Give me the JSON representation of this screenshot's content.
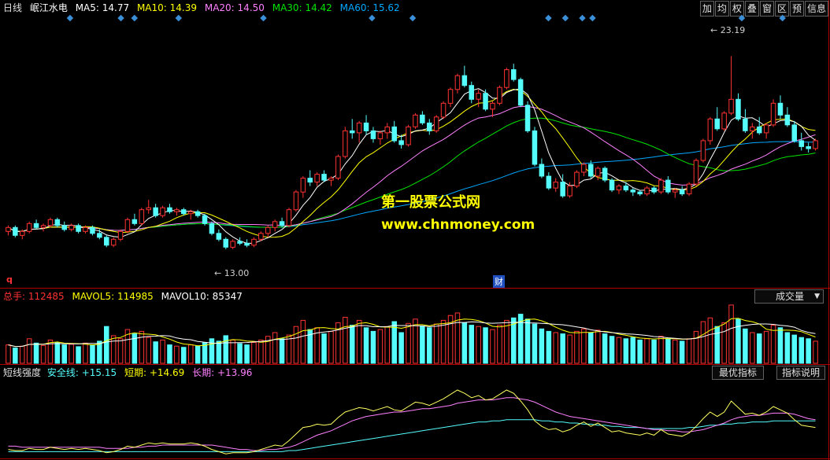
{
  "header": {
    "period": "日线",
    "stock_name": "岷江水电",
    "ma5_label": "MA5:",
    "ma5": "14.77",
    "ma10_label": "MA10:",
    "ma10": "14.39",
    "ma20_label": "MA20:",
    "ma20": "14.50",
    "ma30_label": "MA30:",
    "ma30": "14.42",
    "ma60_label": "MA60:",
    "ma60": "15.62"
  },
  "toolbar": [
    "加",
    "均",
    "权",
    "叠",
    "窗",
    "区",
    "预",
    "信息"
  ],
  "annotations": {
    "high": "23.19",
    "low": "13.00",
    "q_marker": "q",
    "fin_marker": "财"
  },
  "watermark": {
    "line1": "第一股票公式网",
    "line2": "www.chnmoney.com"
  },
  "volume_header": {
    "total_label": "总手:",
    "total": "112485",
    "mavol5_label": "MAVOL5:",
    "mavol5": "114985",
    "mavol10_label": "MAVOL10:",
    "mavol10": "85347",
    "selector": "成交量"
  },
  "indicator_header": {
    "name": "短线强度",
    "safe_label": "安全线:",
    "safe": "+15.15",
    "short_label": "短期:",
    "short": "+14.69",
    "long_label": "长期:",
    "long": "+13.96",
    "btn_optimal": "最优指标",
    "btn_help": "指标说明"
  },
  "colors": {
    "up": "#ff3232",
    "down": "#54fcfc",
    "ma5": "#ffffff",
    "ma10": "#ffff00",
    "ma20": "#ff80ff",
    "ma30": "#00e600",
    "ma60": "#00a8ff",
    "marker": "#3a8fd8"
  },
  "chart_data": {
    "type": "candlestick",
    "price_range": [
      12.0,
      24.2
    ],
    "candles": [
      [
        14.3,
        14.6,
        14.1,
        14.5
      ],
      [
        14.5,
        14.6,
        14.0,
        14.1
      ],
      [
        14.1,
        14.4,
        13.9,
        14.3
      ],
      [
        14.3,
        14.8,
        14.2,
        14.7
      ],
      [
        14.7,
        14.9,
        14.4,
        14.5
      ],
      [
        14.5,
        14.7,
        14.3,
        14.6
      ],
      [
        14.6,
        15.0,
        14.5,
        14.9
      ],
      [
        14.9,
        15.0,
        14.5,
        14.6
      ],
      [
        14.6,
        14.8,
        14.3,
        14.4
      ],
      [
        14.4,
        14.7,
        14.3,
        14.6
      ],
      [
        14.6,
        14.7,
        14.2,
        14.3
      ],
      [
        14.3,
        14.6,
        14.2,
        14.5
      ],
      [
        14.5,
        14.6,
        14.1,
        14.2
      ],
      [
        14.2,
        14.4,
        13.9,
        14.0
      ],
      [
        14.0,
        14.1,
        13.5,
        13.6
      ],
      [
        13.6,
        14.0,
        13.5,
        13.9
      ],
      [
        13.9,
        14.4,
        13.8,
        14.3
      ],
      [
        14.3,
        15.0,
        14.2,
        14.9
      ],
      [
        14.9,
        15.2,
        14.6,
        14.7
      ],
      [
        14.7,
        15.5,
        14.6,
        15.4
      ],
      [
        15.4,
        15.9,
        15.2,
        15.5
      ],
      [
        15.5,
        15.7,
        15.0,
        15.1
      ],
      [
        15.1,
        15.6,
        15.0,
        15.5
      ],
      [
        15.5,
        15.7,
        15.2,
        15.3
      ],
      [
        15.3,
        15.5,
        15.1,
        15.4
      ],
      [
        15.4,
        15.5,
        15.1,
        15.2
      ],
      [
        15.2,
        15.4,
        14.9,
        15.3
      ],
      [
        15.3,
        15.4,
        15.0,
        15.1
      ],
      [
        15.1,
        15.2,
        14.6,
        14.7
      ],
      [
        14.7,
        14.8,
        14.1,
        14.2
      ],
      [
        14.2,
        14.4,
        13.8,
        13.9
      ],
      [
        13.9,
        14.0,
        13.4,
        13.5
      ],
      [
        13.5,
        13.9,
        13.4,
        13.8
      ],
      [
        13.8,
        14.0,
        13.6,
        13.7
      ],
      [
        13.7,
        13.9,
        13.5,
        13.6
      ],
      [
        13.6,
        14.0,
        13.5,
        13.9
      ],
      [
        13.9,
        14.3,
        13.8,
        14.2
      ],
      [
        14.2,
        14.6,
        14.0,
        14.5
      ],
      [
        14.5,
        14.9,
        14.3,
        14.8
      ],
      [
        14.8,
        15.0,
        14.5,
        14.6
      ],
      [
        14.6,
        15.5,
        14.5,
        15.4
      ],
      [
        15.4,
        16.4,
        15.3,
        16.3
      ],
      [
        16.3,
        17.1,
        16.0,
        17.0
      ],
      [
        17.0,
        17.4,
        16.6,
        16.8
      ],
      [
        16.8,
        17.3,
        16.6,
        17.2
      ],
      [
        17.2,
        17.4,
        16.8,
        16.9
      ],
      [
        16.9,
        17.1,
        16.6,
        17.0
      ],
      [
        17.0,
        18.2,
        16.9,
        18.1
      ],
      [
        18.1,
        19.6,
        18.0,
        19.4
      ],
      [
        19.4,
        20.0,
        19.0,
        19.3
      ],
      [
        19.3,
        19.9,
        18.8,
        19.8
      ],
      [
        19.8,
        20.2,
        19.2,
        19.4
      ],
      [
        19.4,
        19.6,
        18.8,
        19.0
      ],
      [
        19.0,
        19.4,
        18.7,
        19.3
      ],
      [
        19.3,
        19.8,
        19.0,
        19.6
      ],
      [
        19.6,
        19.9,
        18.8,
        18.9
      ],
      [
        18.9,
        19.2,
        18.5,
        18.7
      ],
      [
        18.7,
        19.7,
        18.6,
        19.6
      ],
      [
        19.6,
        20.3,
        19.5,
        20.2
      ],
      [
        20.2,
        20.4,
        19.7,
        19.8
      ],
      [
        19.8,
        20.0,
        19.2,
        19.4
      ],
      [
        19.4,
        20.2,
        19.3,
        20.1
      ],
      [
        20.1,
        20.9,
        20.0,
        20.8
      ],
      [
        20.8,
        21.6,
        20.6,
        21.5
      ],
      [
        21.5,
        22.3,
        21.3,
        22.2
      ],
      [
        22.2,
        22.7,
        21.6,
        21.7
      ],
      [
        21.7,
        21.9,
        20.8,
        21.0
      ],
      [
        21.0,
        21.5,
        20.6,
        21.3
      ],
      [
        21.3,
        21.5,
        20.4,
        20.5
      ],
      [
        20.5,
        20.9,
        20.1,
        20.8
      ],
      [
        20.8,
        21.7,
        20.7,
        21.6
      ],
      [
        21.6,
        22.6,
        21.5,
        22.5
      ],
      [
        22.5,
        22.8,
        21.9,
        22.0
      ],
      [
        22.0,
        22.1,
        20.6,
        20.7
      ],
      [
        20.7,
        20.9,
        19.3,
        19.4
      ],
      [
        19.4,
        19.6,
        17.6,
        17.7
      ],
      [
        17.7,
        18.0,
        17.0,
        17.1
      ],
      [
        17.1,
        17.3,
        16.4,
        16.5
      ],
      [
        16.5,
        17.0,
        16.3,
        16.8
      ],
      [
        16.8,
        17.2,
        16.0,
        16.1
      ],
      [
        16.1,
        16.8,
        16.0,
        16.6
      ],
      [
        16.6,
        17.4,
        16.5,
        17.3
      ],
      [
        17.3,
        17.8,
        17.1,
        17.7
      ],
      [
        17.7,
        17.9,
        17.0,
        17.1
      ],
      [
        17.1,
        17.6,
        16.9,
        17.5
      ],
      [
        17.5,
        17.6,
        16.8,
        16.9
      ],
      [
        16.9,
        17.0,
        16.3,
        16.4
      ],
      [
        16.4,
        16.7,
        16.2,
        16.6
      ],
      [
        16.6,
        16.8,
        16.3,
        16.4
      ],
      [
        16.4,
        16.5,
        16.1,
        16.3
      ],
      [
        16.3,
        16.4,
        16.1,
        16.2
      ],
      [
        16.2,
        16.6,
        16.1,
        16.5
      ],
      [
        16.5,
        16.6,
        16.2,
        16.3
      ],
      [
        16.3,
        17.0,
        16.2,
        16.9
      ],
      [
        16.9,
        17.1,
        16.2,
        16.3
      ],
      [
        16.3,
        16.5,
        16.0,
        16.4
      ],
      [
        16.4,
        16.6,
        16.1,
        16.2
      ],
      [
        16.2,
        16.8,
        16.1,
        16.7
      ],
      [
        16.7,
        18.0,
        16.6,
        17.9
      ],
      [
        17.9,
        19.0,
        17.8,
        18.9
      ],
      [
        18.9,
        20.1,
        18.7,
        20.0
      ],
      [
        20.0,
        20.6,
        19.4,
        19.5
      ],
      [
        19.5,
        20.4,
        19.4,
        20.3
      ],
      [
        20.3,
        23.19,
        20.2,
        21.0
      ],
      [
        21.0,
        21.3,
        19.9,
        20.0
      ],
      [
        20.0,
        20.5,
        19.3,
        19.4
      ],
      [
        19.4,
        19.8,
        19.0,
        19.6
      ],
      [
        19.6,
        20.1,
        19.2,
        19.3
      ],
      [
        19.3,
        19.8,
        19.0,
        19.7
      ],
      [
        19.7,
        21.0,
        19.6,
        20.8
      ],
      [
        20.8,
        21.2,
        20.0,
        20.2
      ],
      [
        20.2,
        20.6,
        19.6,
        19.7
      ],
      [
        19.7,
        19.9,
        18.8,
        18.9
      ],
      [
        18.9,
        19.3,
        18.4,
        18.6
      ],
      [
        18.6,
        18.8,
        18.3,
        18.5
      ],
      [
        18.5,
        19.0,
        18.4,
        18.9
      ]
    ],
    "volumes": [
      30,
      25,
      28,
      40,
      33,
      29,
      38,
      34,
      30,
      31,
      27,
      33,
      29,
      36,
      60,
      45,
      40,
      55,
      48,
      52,
      42,
      35,
      38,
      30,
      28,
      26,
      30,
      28,
      34,
      40,
      36,
      45,
      38,
      32,
      30,
      34,
      38,
      44,
      50,
      40,
      46,
      60,
      70,
      55,
      58,
      48,
      52,
      66,
      75,
      62,
      70,
      58,
      52,
      55,
      60,
      68,
      50,
      65,
      72,
      60,
      58,
      64,
      70,
      78,
      82,
      66,
      62,
      60,
      58,
      55,
      62,
      70,
      74,
      80,
      72,
      64,
      56,
      52,
      50,
      48,
      46,
      52,
      56,
      50,
      54,
      48,
      44,
      42,
      40,
      42,
      38,
      40,
      38,
      44,
      40,
      38,
      36,
      40,
      52,
      68,
      74,
      60,
      66,
      95,
      72,
      56,
      50,
      48,
      52,
      62,
      58,
      50,
      46,
      42,
      40,
      36
    ],
    "markers_top": [
      3,
      18,
      22,
      35,
      60,
      92,
      104,
      144,
      149,
      154,
      157,
      201,
      213,
      232
    ],
    "volume_range": [
      0,
      100
    ],
    "indicator": {
      "short": [
        6,
        5,
        5,
        7,
        6,
        6,
        8,
        7,
        6,
        7,
        6,
        7,
        6,
        5,
        3,
        4,
        6,
        9,
        8,
        10,
        12,
        11,
        12,
        11,
        11,
        11,
        12,
        11,
        9,
        6,
        4,
        2,
        3,
        3,
        3,
        4,
        6,
        8,
        10,
        9,
        14,
        20,
        26,
        27,
        29,
        28,
        29,
        35,
        40,
        42,
        44,
        43,
        41,
        43,
        45,
        42,
        41,
        45,
        49,
        48,
        46,
        49,
        52,
        56,
        60,
        57,
        53,
        55,
        51,
        52,
        56,
        60,
        57,
        50,
        42,
        32,
        27,
        24,
        25,
        22,
        24,
        28,
        31,
        27,
        30,
        26,
        22,
        23,
        21,
        20,
        19,
        21,
        19,
        24,
        20,
        19,
        18,
        21,
        27,
        34,
        40,
        36,
        40,
        50,
        44,
        38,
        39,
        37,
        40,
        45,
        42,
        39,
        33,
        28,
        27,
        26
      ],
      "long": [
        9,
        9,
        8,
        8,
        8,
        8,
        8,
        8,
        8,
        8,
        8,
        8,
        8,
        8,
        7,
        7,
        7,
        7,
        8,
        8,
        9,
        9,
        10,
        10,
        10,
        10,
        10,
        10,
        10,
        10,
        9,
        8,
        7,
        6,
        6,
        5,
        5,
        6,
        6,
        7,
        8,
        10,
        13,
        16,
        19,
        21,
        23,
        26,
        29,
        32,
        34,
        36,
        37,
        38,
        39,
        40,
        40,
        41,
        42,
        43,
        43,
        44,
        45,
        46,
        48,
        49,
        50,
        51,
        51,
        51,
        52,
        53,
        53,
        52,
        51,
        49,
        46,
        43,
        40,
        38,
        36,
        35,
        34,
        33,
        32,
        31,
        30,
        29,
        28,
        27,
        26,
        25,
        24,
        24,
        23,
        23,
        22,
        22,
        23,
        24,
        26,
        28,
        30,
        33,
        35,
        36,
        37,
        37,
        38,
        39,
        39,
        39,
        38,
        36,
        34,
        33
      ],
      "safe": [
        4,
        4,
        4,
        4,
        4,
        4,
        4,
        4,
        4,
        4,
        4,
        4,
        4,
        4,
        4,
        4,
        4,
        4,
        4,
        4,
        4,
        4,
        4,
        4,
        4,
        4,
        4,
        4,
        4,
        4,
        4,
        4,
        4,
        4,
        4,
        4,
        4,
        4,
        4,
        4,
        5,
        5,
        6,
        7,
        8,
        9,
        10,
        11,
        12,
        13,
        14,
        15,
        16,
        17,
        18,
        19,
        20,
        21,
        22,
        23,
        24,
        25,
        26,
        27,
        28,
        29,
        30,
        31,
        31,
        32,
        32,
        33,
        33,
        33,
        33,
        33,
        32,
        32,
        31,
        31,
        30,
        30,
        29,
        29,
        28,
        28,
        27,
        27,
        26,
        26,
        26,
        25,
        25,
        25,
        25,
        25,
        25,
        26,
        26,
        27,
        28,
        28,
        29,
        29,
        30,
        30,
        31,
        31,
        31,
        32,
        32,
        32,
        32,
        32,
        32,
        32
      ],
      "range": [
        0,
        70
      ]
    }
  }
}
